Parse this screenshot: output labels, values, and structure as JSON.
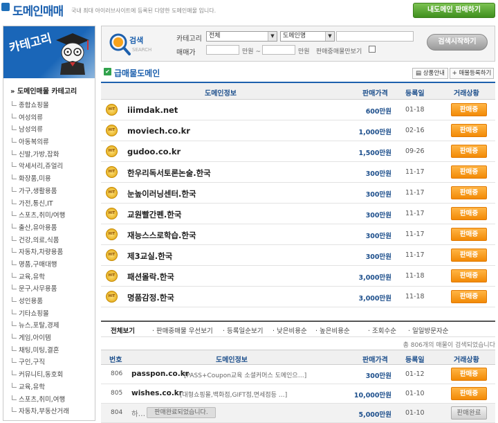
{
  "header": {
    "logo": "도메인매매",
    "tagline": "국내 최대 아이러브사이트에 등록된 다양한 도메인매물 입니다.",
    "sell_button": "내도메인 판매하기"
  },
  "sidebar": {
    "title": "카테고리",
    "subtitle": "» 도메인매물 카테고리",
    "items": [
      "종합쇼핑몰",
      "여성의류",
      "남성의류",
      "아동복의류",
      "신발,가방,잡화",
      "악세서리,쥬얼리",
      "화장품,미용",
      "가구,생활용품",
      "가전,통신,IT",
      "스포츠,취미/여행",
      "출산,유아용품",
      "건강,의료,식품",
      "자동차,차량용품",
      "명품,구매대행",
      "교육,유학",
      "문구,사무용품",
      "성인용품",
      "기타쇼핑몰",
      "뉴스,포탈,경제",
      "게임,아이템",
      "채팅,미팅,결혼",
      "구인,구직",
      "커뮤니티,동호회",
      "교육,유학",
      "스포츠,취미,여행",
      "자동차,부동산거래"
    ]
  },
  "search": {
    "logo_text": "검색",
    "logo_sub": "SEARCH",
    "category_label": "카테고리",
    "price_label": "매매가",
    "category_select": "전체",
    "type_select": "도메인명",
    "unit": "만원",
    "tilde": "~",
    "intermediary_label": "판매중매물만보기",
    "button": "검색시작하기"
  },
  "urgent": {
    "title": "급매물도메인",
    "guide_button": "상품안내",
    "register_button": "+ 매물등록하기",
    "columns": [
      "도메인정보",
      "판매가격",
      "등록일",
      "거래상황"
    ],
    "rows": [
      {
        "domain": "iiimdak.net",
        "price": "600만원",
        "date": "01-18",
        "status": "판매중"
      },
      {
        "domain": "moviech.co.kr",
        "price": "1,000만원",
        "date": "02-16",
        "status": "판매중"
      },
      {
        "domain": "gudoo.co.kr",
        "price": "1,500만원",
        "date": "09-26",
        "status": "판매중"
      },
      {
        "domain": "한우리독서토론논술.한국",
        "price": "300만원",
        "date": "11-17",
        "status": "판매중"
      },
      {
        "domain": "눈높이러닝센터.한국",
        "price": "300만원",
        "date": "11-17",
        "status": "판매중"
      },
      {
        "domain": "교원빨간펜.한국",
        "price": "300만원",
        "date": "11-17",
        "status": "판매중"
      },
      {
        "domain": "재능스스로학습.한국",
        "price": "300만원",
        "date": "11-17",
        "status": "판매중"
      },
      {
        "domain": "제3교실.한국",
        "price": "300만원",
        "date": "11-17",
        "status": "판매중"
      },
      {
        "domain": "패션몰락.한국",
        "price": "3,000만원",
        "date": "11-18",
        "status": "판매중"
      },
      {
        "domain": "명품감정.한국",
        "price": "3,000만원",
        "date": "11-18",
        "status": "판매중"
      }
    ],
    "badge": "HIT"
  },
  "filters": {
    "tabs": [
      "전체보기",
      "판매중매물 우선보기",
      "등록일순보기",
      "낮은비용순",
      "높은비용순",
      "조회수순",
      "일일방문자순"
    ],
    "total_text": "총 806개의 매물이 검색되었습니다"
  },
  "list": {
    "columns": [
      "번호",
      "도메인정보",
      "판매가격",
      "등록일",
      "거래상황"
    ],
    "rows": [
      {
        "no": "806",
        "domain": "passpon.co.kr",
        "desc": "[PASS+Coupon교육 소셜커머스 도메인으…]",
        "price": "300만원",
        "date": "01-12",
        "status": "판매중"
      },
      {
        "no": "805",
        "domain": "wishes.co.kr",
        "desc": "[대형쇼핑몰,백화점,GIFT점,면세점등 …]",
        "price": "10,000만원",
        "date": "01-10",
        "status": "판매중"
      },
      {
        "no": "804",
        "domain": "하…",
        "desc": "판매완료되었습니다.",
        "price": "5,000만원",
        "date": "01-10",
        "status": "판매완료"
      }
    ]
  },
  "colors": {
    "brand_blue": "#1d60ad",
    "sell_green": "#4a9d2a",
    "status_orange": "#f28a06"
  }
}
